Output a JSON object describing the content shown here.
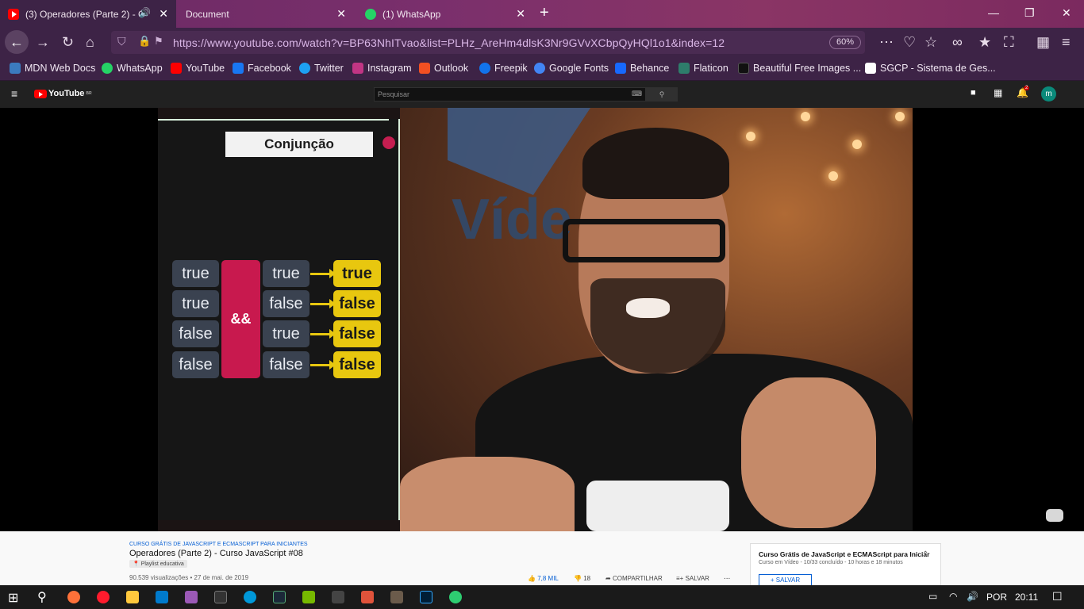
{
  "tabs": [
    {
      "label": "(3) Operadores (Parte 2) - C",
      "active": true
    },
    {
      "label": "Document",
      "active": false
    },
    {
      "label": "(1) WhatsApp",
      "active": false
    }
  ],
  "nav": {
    "url": "https://www.youtube.com/watch?v=BP63NhITvao&list=PLHz_AreHm4dlsK3Nr9GVvXCbpQyHQl1o1&index=12",
    "zoom": "60%"
  },
  "bookmarks": [
    {
      "label": "MDN Web Docs",
      "color": "#3b7bbf"
    },
    {
      "label": "WhatsApp",
      "color": "#25d366"
    },
    {
      "label": "YouTube",
      "color": "#ff0000"
    },
    {
      "label": "Facebook",
      "color": "#1877f2"
    },
    {
      "label": "Twitter",
      "color": "#1da1f2"
    },
    {
      "label": "Instagram",
      "color": "#c13584"
    },
    {
      "label": "Outlook",
      "color": "#f25022"
    },
    {
      "label": "Freepik",
      "color": "#1273eb"
    },
    {
      "label": "Google Fonts",
      "color": "#4285f4"
    },
    {
      "label": "Behance",
      "color": "#1769ff"
    },
    {
      "label": "Flaticon",
      "color": "#2e7d6b"
    },
    {
      "label": "Beautiful Free Images ...",
      "color": "#111111"
    },
    {
      "label": "SGCP - Sistema de Ges...",
      "color": "#ffffff"
    }
  ],
  "youtube": {
    "logo_text": "YouTube",
    "region": "BR",
    "search_placeholder": "Pesquisar",
    "notifications": "2",
    "avatar_letter": "m"
  },
  "slide": {
    "title": "Conjunção",
    "operator": "&&",
    "rows": [
      {
        "a": "true",
        "b": "true",
        "result": "true"
      },
      {
        "a": "true",
        "b": "false",
        "result": "false"
      },
      {
        "a": "false",
        "b": "true",
        "result": "false"
      },
      {
        "a": "false",
        "b": "false",
        "result": "false"
      }
    ]
  },
  "video_info": {
    "playlist_tag": "CURSO GRÁTIS DE JAVASCRIPT E ECMASCRIPT PARA INICIANTES",
    "title": "Operadores (Parte 2) - Curso JavaScript #08",
    "badge": "Playlist educativa",
    "views": "90.539 visualizações • 27 de mai. de 2019",
    "likes": "7,8 MIL",
    "dislikes": "18",
    "share": "COMPARTILHAR",
    "save": "SALVAR",
    "more": "..."
  },
  "playlist": {
    "title": "Curso Grátis de JavaScript e ECMAScript para Iniciar",
    "subtitle": "Curso em Vídeo - 10/33 concluído - 10 horas e 18 minutos",
    "save": "SALVAR"
  },
  "taskbar": {
    "language": "POR",
    "time": "20:11"
  }
}
